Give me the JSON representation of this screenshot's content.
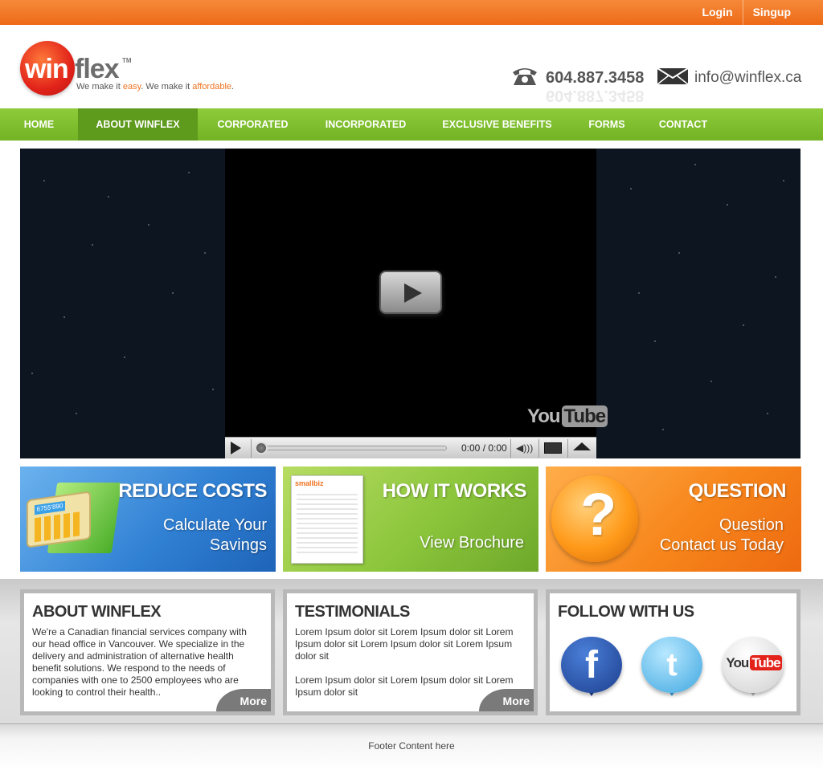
{
  "topbar": {
    "login": "Login",
    "signup": "Singup"
  },
  "brand": {
    "win": "win",
    "flex": "flex",
    "tm": "TM",
    "tagline_1": "We make it ",
    "tagline_easy": "easy",
    "tagline_2": ". We make it ",
    "tagline_affordable": "affordable",
    "tagline_3": ".",
    "accent_orange": "#f07320"
  },
  "contact": {
    "phone": "604.887.3458",
    "email": "info@winflex.ca",
    "phone_icon": "telephone-icon",
    "mail_icon": "envelope-icon"
  },
  "nav": {
    "items": [
      "HOME",
      "ABOUT WINFLEX",
      "CORPORATED",
      "INCORPORATED",
      "EXCLUSIVE BENEFITS",
      "FORMS",
      "CONTACT"
    ],
    "active": "ABOUT WINFLEX",
    "color": "#7fbf2f"
  },
  "video": {
    "time": "0:00 / 0:00",
    "logo_you": "You",
    "logo_tube": "Tube"
  },
  "promos": {
    "reduce": {
      "title": "REDUCE COSTS",
      "line1": "Calculate Your",
      "line2": "Savings",
      "calc_display": "6755'890"
    },
    "how": {
      "title": "HOW IT WORKS",
      "line1": "View Brochure",
      "brochure_brand": "smallbiz"
    },
    "question": {
      "title": "QUESTION",
      "line1": "Question",
      "line2": "Contact us Today"
    }
  },
  "about": {
    "title": "ABOUT WINFLEX",
    "body": "We're a Canadian financial services company with our head office in Vancouver. We specialize in the delivery and administration of alternative health benefit solutions. We respond to the needs of companies with one to 2500 employees who are looking to control their health..",
    "more": "More"
  },
  "testimonials": {
    "title": "TESTIMONIALS",
    "body1": "Lorem Ipsum dolor sit Lorem Ipsum dolor sit Lorem Ipsum dolor sit  Lorem Ipsum dolor sit Lorem Ipsum dolor sit",
    "body2": "Lorem Ipsum dolor sit Lorem Ipsum dolor sit Lorem Ipsum dolor sit",
    "more": "More"
  },
  "follow": {
    "title": "FOLLOW WITH US",
    "facebook": "f",
    "youtube_you": "You",
    "youtube_tube": "Tube"
  },
  "footer": {
    "text": "Footer Content here"
  }
}
